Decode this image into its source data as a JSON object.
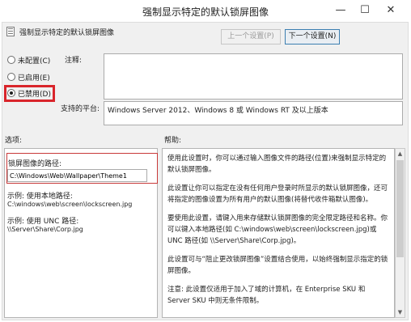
{
  "window": {
    "title": "强制显示特定的默认锁屏图像",
    "minimize_glyph": "—",
    "maximize_glyph": "☐",
    "close_glyph": "✕"
  },
  "header": {
    "policy_name": "强制显示特定的默认锁屏图像",
    "prev_button": "上一个设置(P)",
    "next_button": "下一个设置(N)"
  },
  "state": {
    "options": [
      {
        "label": "未配置(C)",
        "checked": false
      },
      {
        "label": "已启用(E)",
        "checked": false
      },
      {
        "label": "已禁用(D)",
        "checked": true
      }
    ],
    "highlight_color": "#d9252b"
  },
  "comment": {
    "label": "注释:",
    "value": ""
  },
  "supported": {
    "label": "支持的平台:",
    "value": "Windows Server 2012、Windows 8 或 Windows RT 及以上版本"
  },
  "options_section": {
    "header": "选项:",
    "path_label": "锁屏图像的路径:",
    "path_value": "C:\\Windows\\Web\\Wallpaper\\Theme1",
    "example1_label": "示例: 使用本地路径:",
    "example1_value": "C:\\windows\\web\\screen\\lockscreen.jpg",
    "example2_label": "示例: 使用 UNC 路径:",
    "example2_value": "\\\\Server\\Share\\Corp.jpg"
  },
  "help_section": {
    "header": "帮助:",
    "paragraphs": [
      "使用此设置时，你可以通过输入图像文件的路径(位置)来强制显示特定的默认锁屏图像。",
      "此设置让你可以指定在没有任何用户登录时所显示的默认锁屏图像，还可将指定的图像设置为所有用户的默认图像(将替代收件箱默认图像)。",
      "要使用此设置，请键入用来存储默认锁屏图像的完全限定路径和名称。你可以键入本地路径(如 C:\\windows\\web\\screen\\lockscreen.jpg)或 UNC 路径(如 \\\\Server\\Share\\Corp.jpg)。",
      "此设置可与“阻止更改锁屏图像”设置结合使用，以始终强制显示指定的锁屏图像。",
      "注意: 此设置仅适用于加入了域的计算机，在 Enterprise SKU 和 Server SKU 中则无条件限制。"
    ]
  }
}
